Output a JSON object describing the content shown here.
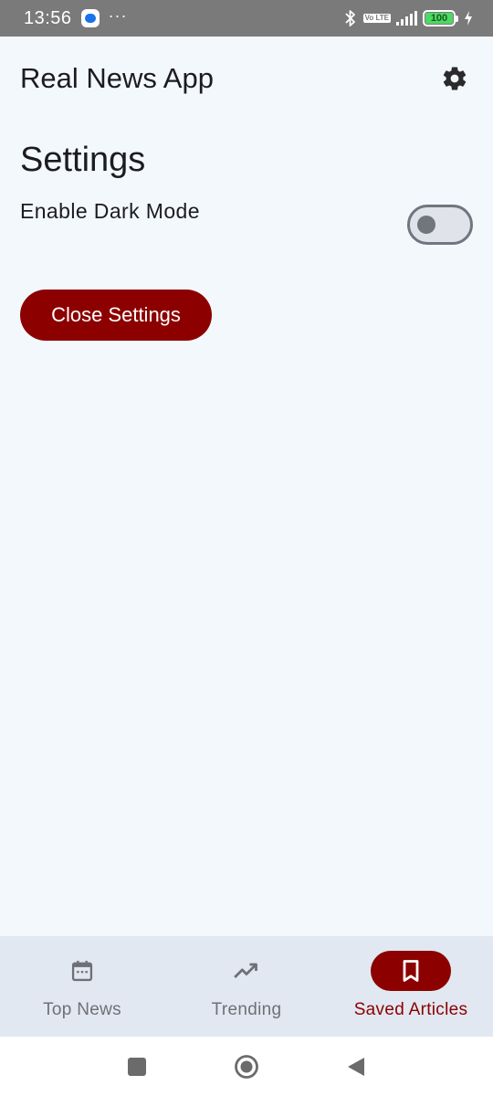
{
  "status_bar": {
    "time": "13:56",
    "more": "···",
    "volte": "Vo LTE",
    "battery": "100"
  },
  "header": {
    "title": "Real News App",
    "settings_icon": "gear-icon"
  },
  "settings": {
    "title": "Settings",
    "dark_mode_label": "Enable Dark Mode",
    "dark_mode_enabled": false,
    "close_label": "Close Settings"
  },
  "bottom_nav": {
    "items": [
      {
        "label": "Top News",
        "icon": "calendar-icon",
        "active": false
      },
      {
        "label": "Trending",
        "icon": "trending-up-icon",
        "active": false
      },
      {
        "label": "Saved Articles",
        "icon": "bookmark-icon",
        "active": true
      }
    ]
  },
  "system_nav": {
    "icons": [
      "square-recents-icon",
      "circle-home-icon",
      "triangle-back-icon"
    ]
  },
  "colors": {
    "accent": "#8c0000",
    "background": "#f3f8fd",
    "nav_background": "#e1e8f1",
    "status_bar": "#7a7a7a"
  }
}
